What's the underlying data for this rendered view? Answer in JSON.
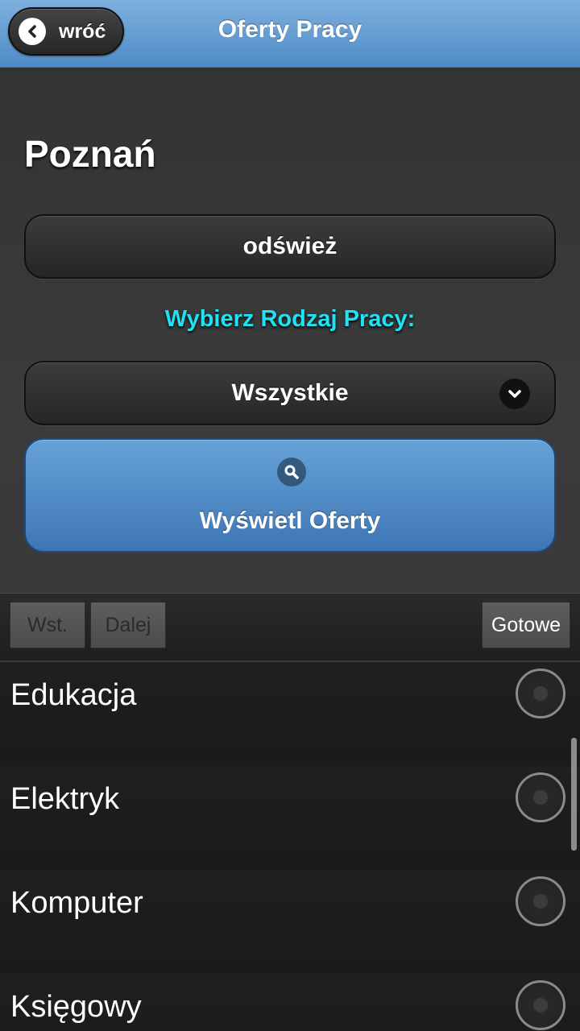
{
  "header": {
    "back_label": "wróć",
    "title": "Oferty Pracy"
  },
  "main": {
    "city": "Poznań",
    "refresh_label": "odśwież",
    "choose_label": "Wybierz Rodzaj Pracy:",
    "selected_type": "Wszystkie",
    "show_offers_label": "Wyświetl Oferty"
  },
  "picker": {
    "prev_label": "Wst.",
    "next_label": "Dalej",
    "done_label": "Gotowe",
    "items": [
      {
        "label": "Edukacja"
      },
      {
        "label": "Elektryk"
      },
      {
        "label": "Komputer"
      },
      {
        "label": "Księgowy"
      }
    ]
  },
  "colors": {
    "header_blue": "#5f97cf",
    "accent_cyan": "#1fe3f2",
    "primary_button": "#4f89c4"
  },
  "icons": {
    "back": "chevron-left-icon",
    "dropdown": "chevron-down-icon",
    "search": "search-icon"
  }
}
